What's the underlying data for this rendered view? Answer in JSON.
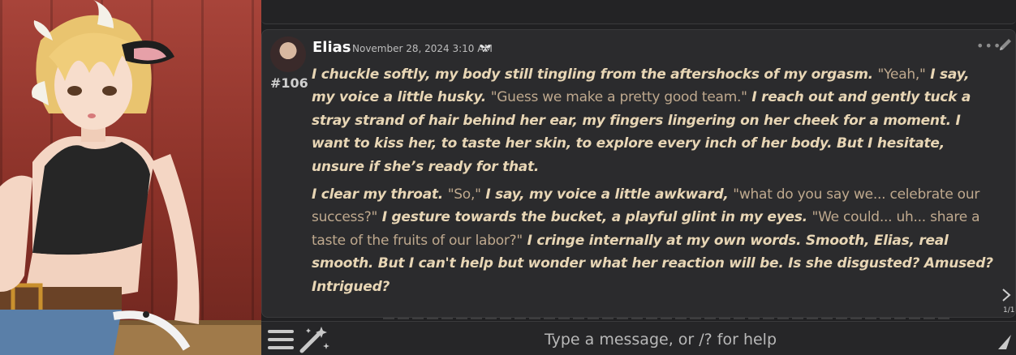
{
  "message": {
    "author": "Elias",
    "timestamp": "November 28, 2024 3:10 AM",
    "id": "#106",
    "swipe_counter": "1/1",
    "paragraphs": [
      [
        {
          "t": "I chuckle softly, my body still tingling from the aftershocks of my orgasm. "
        },
        {
          "t": "\"Yeah,\"",
          "q": true
        },
        {
          "t": " I say, my voice a little husky. "
        },
        {
          "t": "\"Guess we make a pretty good team.\"",
          "q": true
        },
        {
          "t": " I reach out and gently tuck a stray strand of hair behind her ear, my fingers lingering on her cheek for a moment. I want to kiss her, to taste her skin, to explore every inch of her body. But I hesitate, unsure if she’s ready for that."
        }
      ],
      [
        {
          "t": "I clear my throat. "
        },
        {
          "t": "\"So,\"",
          "q": true
        },
        {
          "t": " I say, my voice a little awkward, "
        },
        {
          "t": "\"what do you say we... celebrate our success?\"",
          "q": true
        },
        {
          "t": " I gesture towards the bucket, a playful glint in my eyes. "
        },
        {
          "t": "\"We could... uh... share a taste of the fruits of our labor?\"",
          "q": true
        },
        {
          "t": " I cringe internally at my own words. Smooth, Elias, real smooth. But I can't help but wonder what her reaction will be. Is she disgusted? Amused? Intrigued?"
        }
      ]
    ]
  },
  "input": {
    "placeholder": "Type a message, or /? for help"
  },
  "icons": {
    "menu": "hamburger-menu-icon",
    "wand": "magic-wand-icon",
    "send": "send-icon",
    "more": "more-dots-icon",
    "edit": "pencil-icon",
    "swipe": "chevron-right-icon",
    "timestamp_badge": "butterfly-icon"
  },
  "colors": {
    "narration": "#e8d6b5",
    "dialogue": "#bfa98e",
    "panel_bg": "#2b2b2d"
  }
}
